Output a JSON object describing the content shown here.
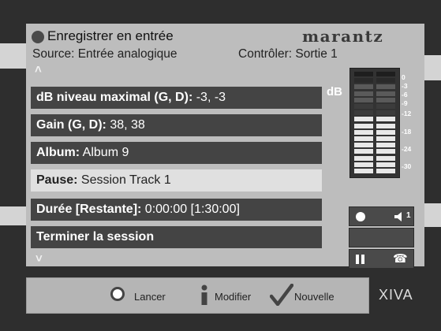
{
  "header": {
    "title": "Enregistrer en entrée",
    "brand": "marantz",
    "source": "Source: Entrée analogique",
    "control": "Contrôler: Sortie 1"
  },
  "menu": {
    "items": [
      {
        "label": "dB niveau maximal (G, D):",
        "value": " -3, -3"
      },
      {
        "label": "Gain (G, D):",
        "value": " 38, 38"
      },
      {
        "label": "Album:",
        "value": " Album 9"
      },
      {
        "label": "Pause:",
        "value": " Session Track 1"
      },
      {
        "label": "Durée [Restante]:",
        "value": " 0:00:00 [1:30:00]"
      },
      {
        "label": "Terminer la session",
        "value": ""
      }
    ],
    "selected_index": 3
  },
  "meter": {
    "label": "dB",
    "scale": [
      "0",
      "-3",
      "-6",
      "-9",
      "-12",
      "-18",
      "-24",
      "-30"
    ],
    "level_left_db": -3,
    "level_right_db": -3
  },
  "controls": {
    "volume_label": "1"
  },
  "footer": {
    "launch_label": "Lancer",
    "modify_label": "Modifier",
    "new_label": "Nouvelle",
    "brand": "XIVA"
  },
  "colors": {
    "panel": "#bdbdbd",
    "row": "#444444",
    "row_selected": "#e0e0e0"
  }
}
